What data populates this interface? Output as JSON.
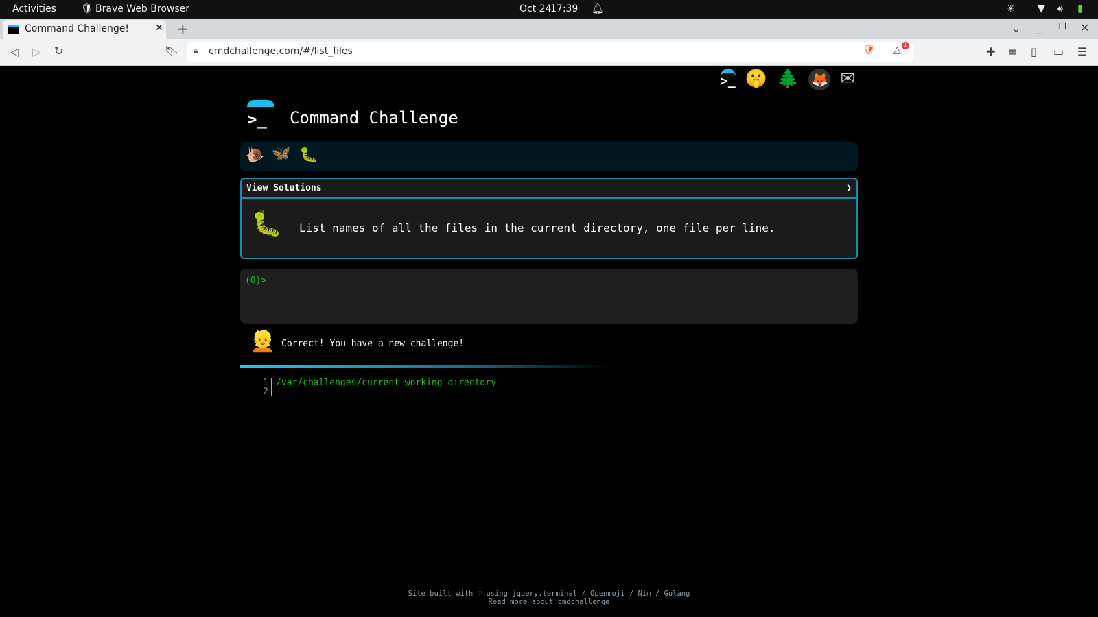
{
  "system": {
    "activities": "Activities",
    "app_name": "Brave Web Browser",
    "date": "Oct 24",
    "time": "17:39"
  },
  "browser": {
    "tab_title": "Command Challenge!",
    "new_tab": "+",
    "url": "cmdchallenge.com/#/list_files",
    "rewards_badge": "1"
  },
  "page": {
    "title": "Command Challenge",
    "header_icons": [
      "terminal-icon",
      "shushing-face-icon",
      "tree-icon",
      "gitlab-icon",
      "mail-icon"
    ],
    "progress_emojis": [
      "snail",
      "butterfly",
      "caterpillar"
    ],
    "solutions": {
      "label": "View Solutions",
      "chevron": "❯"
    },
    "challenge": "List names of all the files in the current directory, one file per line.",
    "prompt": "(0)>",
    "message": "Correct! You have a new challenge!",
    "output": {
      "lines": [
        {
          "num": "1",
          "text": "/var/challenges/current_working_directory"
        },
        {
          "num": "2",
          "text": ""
        }
      ]
    },
    "footer": {
      "line1": "Site built with ♡ using jquery.terminal / Openmoji / Nim / Golang",
      "line2": "Read more about cmdchallenge"
    }
  },
  "colors": {
    "accent": "#1b8bb0",
    "prompt_green": "#1ec21e",
    "terminal_bg": "#1e1e1e"
  }
}
